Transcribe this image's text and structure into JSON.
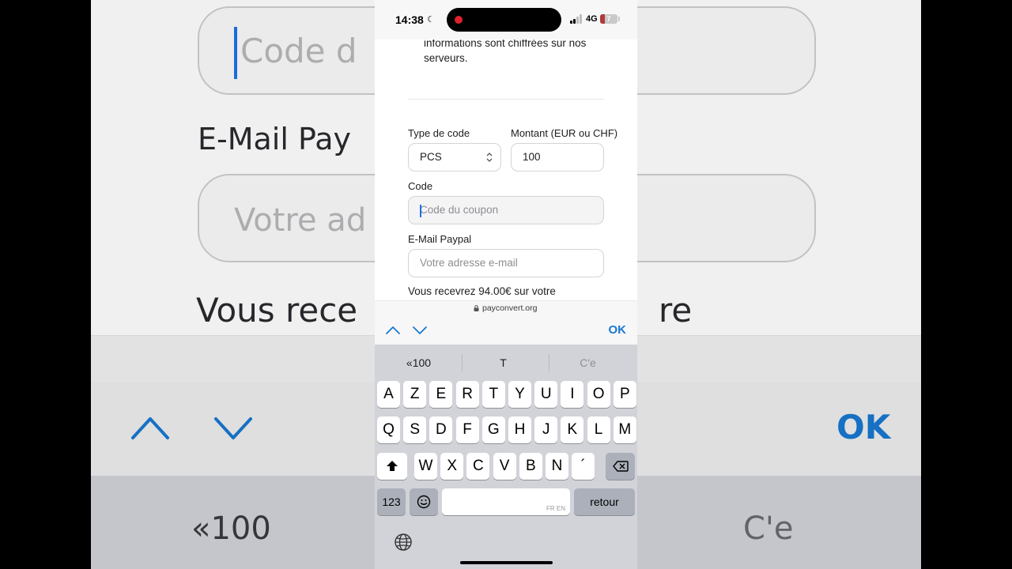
{
  "status_bar": {
    "time": "14:38",
    "network": "4G",
    "battery": "7",
    "battery_level_percent": 7
  },
  "page": {
    "info_line_1": "informations sont chiffrées sur nos",
    "info_line_2": "serveurs.",
    "code_type_label": "Type de code",
    "code_type_value": "PCS",
    "amount_label": "Montant (EUR ou CHF)",
    "amount_value": "100",
    "coupon_label": "Code",
    "coupon_placeholder": "Code du coupon",
    "email_label": "E-Mail Paypal",
    "email_placeholder": "Votre adresse e-mail",
    "receive_text": "Vous recevrez 94.00€ sur votre"
  },
  "url_bar": {
    "domain": "payconvert.org"
  },
  "accessory": {
    "ok_label": "OK"
  },
  "keyboard": {
    "suggestions": [
      "«100",
      "T",
      "C'e"
    ],
    "row1": [
      "A",
      "Z",
      "E",
      "R",
      "T",
      "Y",
      "U",
      "I",
      "O",
      "P"
    ],
    "row2": [
      "Q",
      "S",
      "D",
      "F",
      "G",
      "H",
      "J",
      "K",
      "L",
      "M"
    ],
    "row3": [
      "W",
      "X",
      "C",
      "V",
      "B",
      "N",
      "´"
    ],
    "numbers_key": "123",
    "space_hint": "FR EN",
    "return_key": "retour"
  },
  "backdrop": {
    "coupon_fragment": "Code d",
    "email_label_fragment": "E-Mail Pay",
    "email_input_fragment": "Votre ad",
    "receive_fragment": "Vous rece",
    "receive_tail": "re",
    "ok_label": "OK",
    "suggestion_left": "«100",
    "suggestion_right": "C'e"
  },
  "colors": {
    "accent": "#1878d0",
    "keyboard_bg": "#d1d3d9",
    "record_dot": "#e0212b"
  }
}
